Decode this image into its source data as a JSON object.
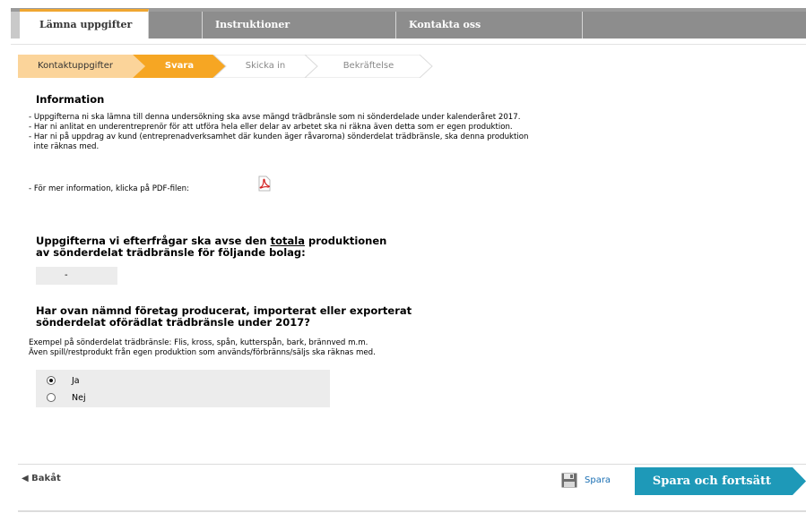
{
  "tabs": [
    {
      "label": "Lämna uppgifter",
      "active": true
    },
    {
      "label": "Instruktioner",
      "active": false
    },
    {
      "label": "Kontakta oss",
      "active": false
    }
  ],
  "steps": [
    {
      "label": "Kontaktuppgifter",
      "state": "done"
    },
    {
      "label": "Svara",
      "state": "current"
    },
    {
      "label": "Skicka in",
      "state": "todo"
    },
    {
      "label": "Bekräftelse",
      "state": "todo"
    }
  ],
  "info": {
    "title": "Information",
    "lines": [
      "- Uppgifterna ni ska lämna till denna undersökning ska avse mängd trädbränsle som ni sönderdelade under kalenderåret 2017.",
      "- Har ni anlitat en underentreprenör för att utföra hela eller delar av arbetet ska ni räkna även detta som er egen produktion.",
      "- Har ni på uppdrag av kund (entreprenadverksamhet där kunden äger råvarorna) sönderdelat trädbränsle, ska denna produktion",
      "  inte räknas med."
    ],
    "pdf_text": "- För mer information, klicka på PDF-filen:",
    "pdf_icon": "pdf-icon"
  },
  "question1": {
    "line1_pre": "Uppgifterna vi efterfrågar ska avse den ",
    "line1_underlined": "totala",
    "line1_post": " produktionen",
    "line2": "av sönderdelat trädbränsle för följande bolag:",
    "company_value": "-"
  },
  "question2": {
    "line1": "Har ovan nämnd företag producerat, importerat eller exporterat",
    "line2": "sönderdelat oförädlat trädbränsle under 2017?",
    "help1": "Exempel på sönderdelat trädbränsle: Flis, kross, spån, kutterspån, bark, brännved m.m.",
    "help2": "Även spill/restprodukt från egen produktion som används/förbränns/säljs ska räknas med.",
    "options": [
      {
        "label": "Ja",
        "checked": true
      },
      {
        "label": "Nej",
        "checked": false
      }
    ]
  },
  "footer": {
    "back_label": "◀ Bakåt",
    "save_label": "Spara",
    "continue_label": "Spara och fortsätt",
    "colors": {
      "accent": "#f0a630",
      "continue": "#1e99b8",
      "link": "#1a6fb3"
    }
  }
}
